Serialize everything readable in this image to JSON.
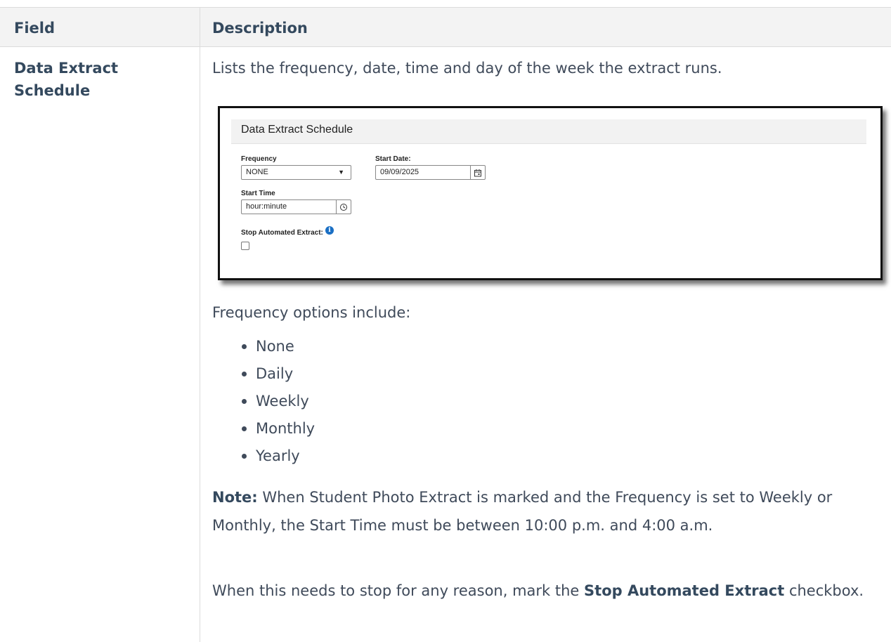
{
  "table": {
    "headers": {
      "field": "Field",
      "description": "Description"
    },
    "row": {
      "field": "Data Extract Schedule",
      "intro": "Lists the frequency, date, time and day of the week the extract runs.",
      "screenshot": {
        "title": "Data Extract Schedule",
        "frequency_label": "Frequency",
        "frequency_value": "NONE",
        "start_date_label": "Start Date:",
        "start_date_value": "09/09/2025",
        "start_time_label": "Start Time",
        "start_time_placeholder": "hour:minute",
        "stop_label": "Stop Automated Extract:",
        "stop_checked": false
      },
      "options_label": "Frequency options include:",
      "options": [
        "None",
        "Daily",
        "Weekly",
        "Monthly",
        "Yearly"
      ],
      "note_label": "Note:",
      "note_text": " When Student Photo Extract is marked and the Frequency is set to Weekly or Monthly, the Start Time must be between 10:00 p.m. and 4:00 a.m.",
      "stop_text_before": "When this needs to stop for any reason, mark the ",
      "stop_text_bold": "Stop Automated Extract",
      "stop_text_after": " checkbox."
    }
  },
  "colors": {
    "header_bg": "#f3f3f3",
    "heading_text": "#34495e",
    "body_text": "#3f4a5a",
    "info_blue": "#1a6fc4"
  }
}
